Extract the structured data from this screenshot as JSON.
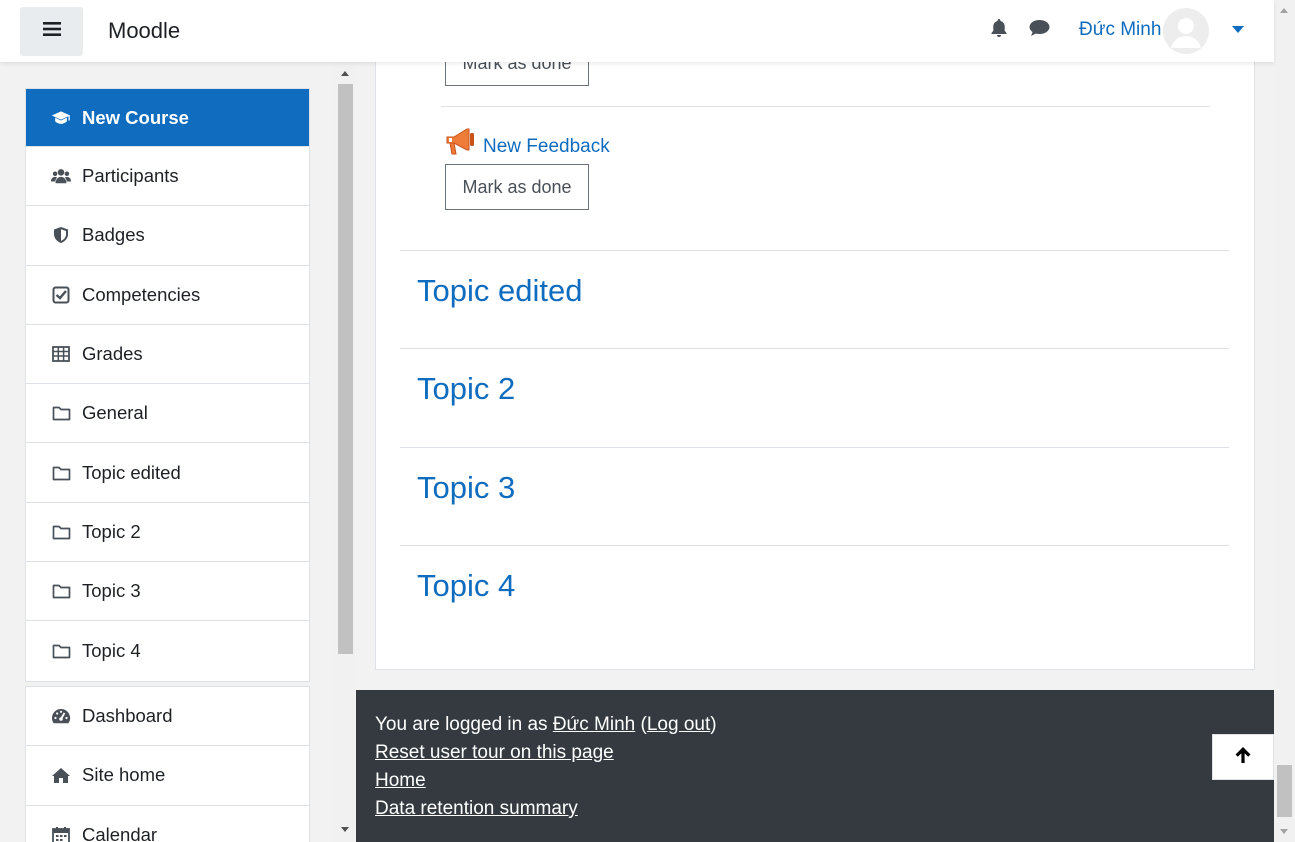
{
  "navbar": {
    "brand": "Moodle",
    "user_name": "Đức Minh",
    "icons": [
      "menu-icon",
      "bell-icon",
      "chat-icon",
      "avatar",
      "chevron-down-icon"
    ]
  },
  "drawer": {
    "course_items": [
      {
        "label": "New Course",
        "icon": "graduation-cap-icon",
        "active": true
      },
      {
        "label": "Participants",
        "icon": "users-icon"
      },
      {
        "label": "Badges",
        "icon": "shield-icon"
      },
      {
        "label": "Competencies",
        "icon": "check-square-icon"
      },
      {
        "label": "Grades",
        "icon": "table-icon"
      },
      {
        "label": "General",
        "icon": "folder-icon"
      },
      {
        "label": "Topic edited",
        "icon": "folder-icon"
      },
      {
        "label": "Topic 2",
        "icon": "folder-icon"
      },
      {
        "label": "Topic 3",
        "icon": "folder-icon"
      },
      {
        "label": "Topic 4",
        "icon": "folder-icon"
      }
    ],
    "site_items": [
      {
        "label": "Dashboard",
        "icon": "dashboard-icon"
      },
      {
        "label": "Site home",
        "icon": "home-icon"
      },
      {
        "label": "Calendar",
        "icon": "calendar-icon"
      }
    ]
  },
  "content": {
    "mark_done_label": "Mark as done",
    "activity": {
      "label": "New Feedback",
      "icon": "megaphone-icon"
    },
    "sections": [
      "Topic edited",
      "Topic 2",
      "Topic 3",
      "Topic 4"
    ]
  },
  "footer": {
    "logged_in_prefix": "You are logged in as ",
    "user_name": "Đức Minh",
    "open_paren": " (",
    "logout": "Log out",
    "close_paren": ")",
    "reset_tour": "Reset user tour on this page",
    "home": "Home",
    "data_retention": "Data retention summary"
  },
  "colors": {
    "accent": "#0f6cbf",
    "footer_bg": "#343a40",
    "activity_icon": "#f07c3a"
  }
}
